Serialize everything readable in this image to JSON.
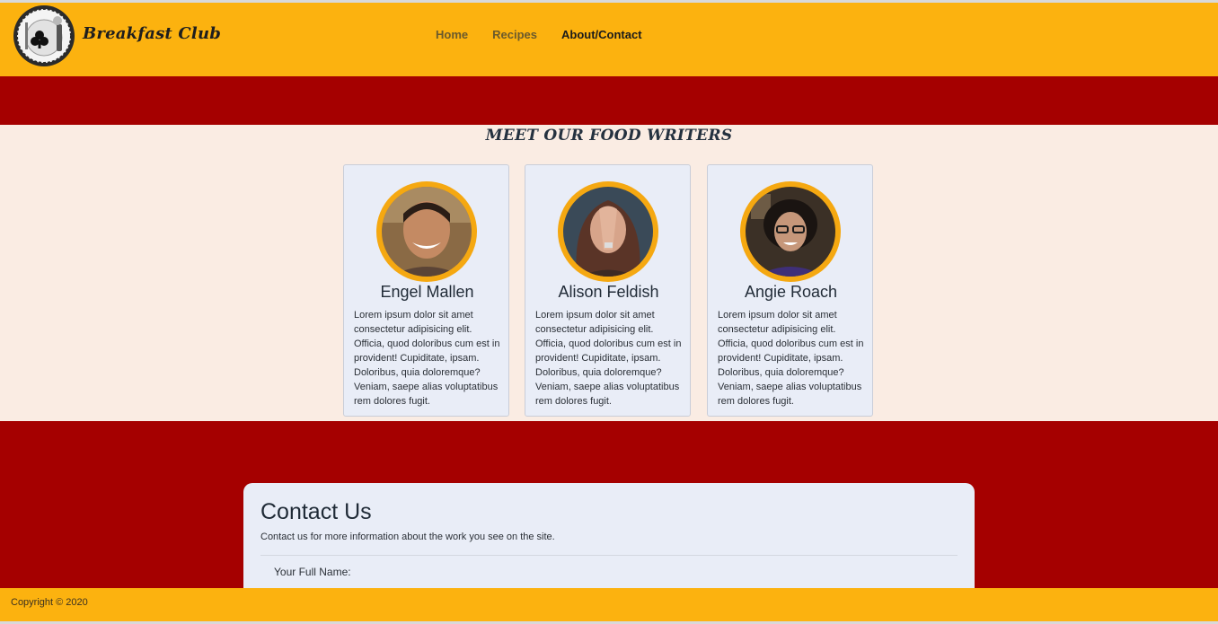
{
  "header": {
    "brand": "Breakfast Club",
    "nav": [
      {
        "label": "Home"
      },
      {
        "label": "Recipes"
      },
      {
        "label": "About/Contact"
      }
    ]
  },
  "writers": {
    "title": "MEET OUR FOOD WRITERS",
    "cards": [
      {
        "name": "Engel Mallen",
        "text": "Lorem ipsum dolor sit amet consectetur adipisicing elit. Officia, quod doloribus cum est in provident! Cupiditate, ipsam. Doloribus, quia doloremque? Veniam, saepe alias voluptatibus rem dolores fugit."
      },
      {
        "name": "Alison Feldish",
        "text": "Lorem ipsum dolor sit amet consectetur adipisicing elit. Officia, quod doloribus cum est in provident! Cupiditate, ipsam. Doloribus, quia doloremque? Veniam, saepe alias voluptatibus rem dolores fugit."
      },
      {
        "name": "Angie Roach",
        "text": "Lorem ipsum dolor sit amet consectetur adipisicing elit. Officia, quod doloribus cum est in provident! Cupiditate, ipsam. Doloribus, quia doloremque? Veniam, saepe alias voluptatibus rem dolores fugit."
      }
    ]
  },
  "contact": {
    "title": "Contact Us",
    "subtitle": "Contact us for more information about the work you see on the site.",
    "field_label": "Your Full Name:"
  },
  "footer": {
    "copyright": "Copyright © 2020"
  },
  "colors": {
    "accent": "#fcb20f",
    "band": "#a50000",
    "writers_bg": "#faece3",
    "card_bg": "#e9edf7"
  }
}
